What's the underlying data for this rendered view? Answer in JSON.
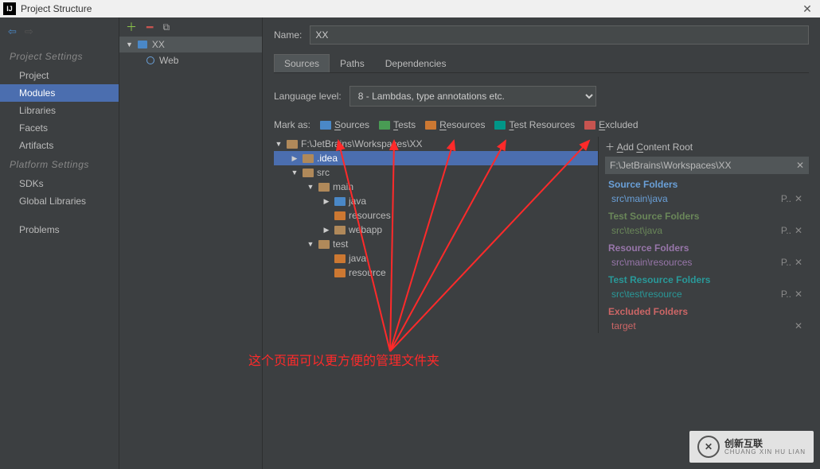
{
  "window": {
    "title": "Project Structure",
    "close": "✕"
  },
  "leftnav": {
    "back_disabled": false,
    "heading1": "Project Settings",
    "items1": [
      "Project",
      "Modules",
      "Libraries",
      "Facets",
      "Artifacts"
    ],
    "selected1": 1,
    "heading2": "Platform Settings",
    "items2": [
      "SDKs",
      "Global Libraries"
    ],
    "problems": "Problems"
  },
  "modules": {
    "root": "XX",
    "children": [
      {
        "label": "Web"
      }
    ]
  },
  "header": {
    "name_label": "Name:",
    "name_value": "XX",
    "tabs": [
      "Sources",
      "Paths",
      "Dependencies"
    ],
    "active_tab": 0
  },
  "source_tab": {
    "lang_label": "Language level:",
    "lang_value": "8 - Lambdas, type annotations etc.",
    "mark_label": "Mark as:",
    "mark_buttons": [
      {
        "label": "Sources",
        "u": "S",
        "color": "sw-blue"
      },
      {
        "label": "Tests",
        "u": "T",
        "color": "sw-green"
      },
      {
        "label": "Resources",
        "u": "R",
        "color": "sw-orange"
      },
      {
        "label": "Test Resources",
        "u": "T",
        "color": "sw-teal"
      },
      {
        "label": "Excluded",
        "u": "E",
        "color": "sw-red"
      }
    ],
    "tree": {
      "root": "F:\\JetBrains\\Workspaces\\XX",
      "nodes": [
        {
          "label": ".idea",
          "depth": 1,
          "arrow": "▶",
          "sel": true
        },
        {
          "label": "src",
          "depth": 1,
          "arrow": "▼"
        },
        {
          "label": "main",
          "depth": 2,
          "arrow": "▼"
        },
        {
          "label": "java",
          "depth": 3,
          "arrow": "▶",
          "color": "blue"
        },
        {
          "label": "resources",
          "depth": 3,
          "arrow": "",
          "color": "yellow"
        },
        {
          "label": "webapp",
          "depth": 3,
          "arrow": "▶"
        },
        {
          "label": "test",
          "depth": 2,
          "arrow": "▼"
        },
        {
          "label": "java",
          "depth": 3,
          "arrow": "",
          "color": "yellow"
        },
        {
          "label": "resource",
          "depth": 3,
          "arrow": "",
          "color": "yellow"
        }
      ]
    },
    "roots": {
      "add_label": "Add Content Root",
      "path": "F:\\JetBrains\\Workspaces\\XX",
      "groups": [
        {
          "title": "Source Folders",
          "color": "c-blue",
          "entries": [
            "src\\main\\java"
          ]
        },
        {
          "title": "Test Source Folders",
          "color": "c-green",
          "entries": [
            "src\\test\\java"
          ]
        },
        {
          "title": "Resource Folders",
          "color": "c-purple",
          "entries": [
            "src\\main\\resources"
          ]
        },
        {
          "title": "Test Resource Folders",
          "color": "c-teal",
          "entries": [
            "src\\test\\resource"
          ]
        },
        {
          "title": "Excluded Folders",
          "color": "c-red",
          "entries": [
            "target"
          ]
        }
      ]
    }
  },
  "annotation": "这个页面可以更方便的管理文件夹",
  "watermark": {
    "brand": "创新互联",
    "sub": "CHUANG XIN HU LIAN"
  }
}
